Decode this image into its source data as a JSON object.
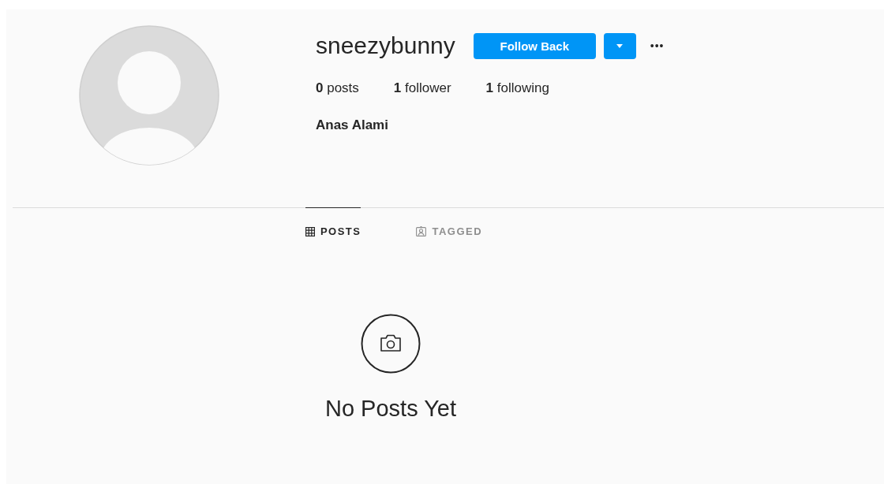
{
  "profile": {
    "username": "sneezybunny",
    "follow_button": "Follow Back",
    "more": "•••",
    "stats": [
      {
        "count": "0",
        "label": "posts"
      },
      {
        "count": "1",
        "label": "follower"
      },
      {
        "count": "1",
        "label": "following"
      }
    ],
    "full_name": "Anas Alami"
  },
  "tabs": [
    {
      "label": "POSTS",
      "kind": "grid",
      "selected": true
    },
    {
      "label": "TAGGED",
      "kind": "tagged",
      "selected": false
    }
  ],
  "empty_state": {
    "message": "No Posts Yet"
  }
}
